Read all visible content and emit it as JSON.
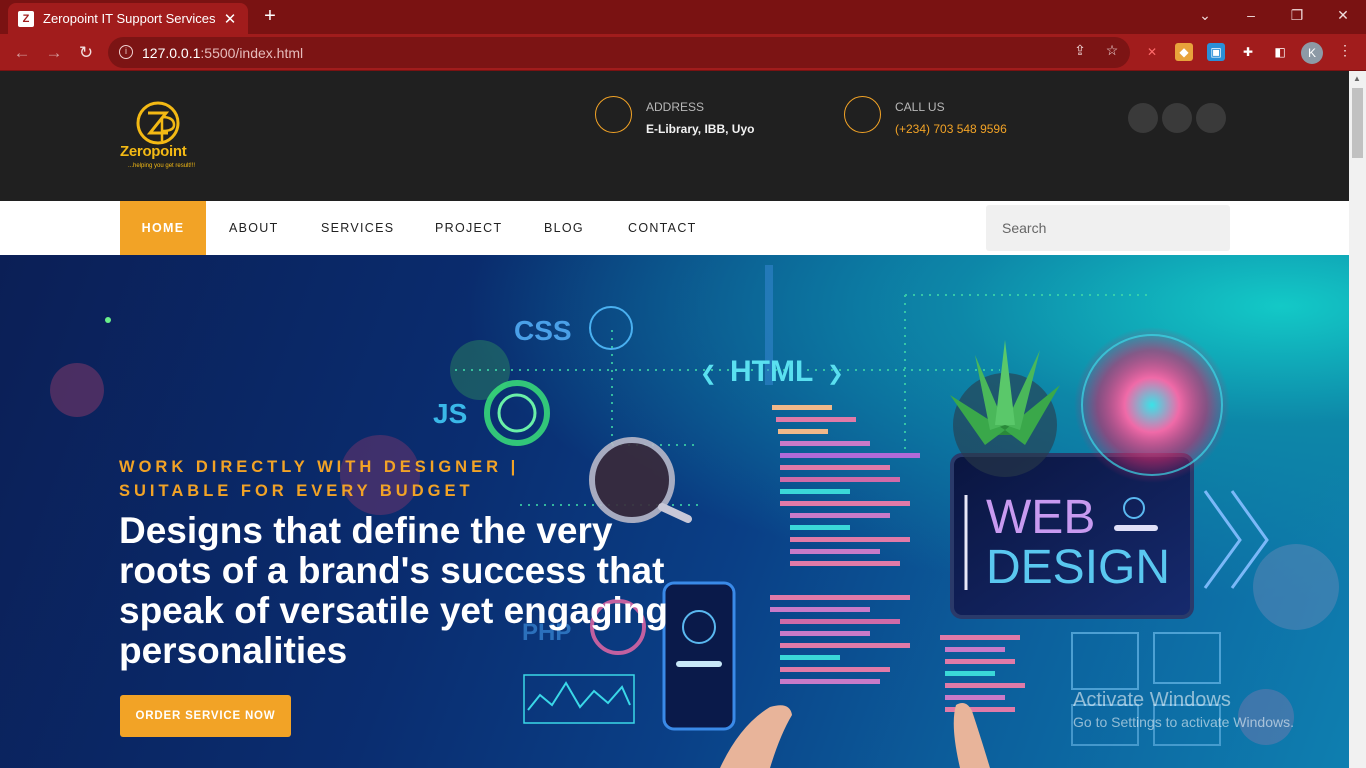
{
  "browser": {
    "tab_title": "Zeropoint IT Support Services",
    "tab_close": "✕",
    "new_tab": "+",
    "url_host": "127.0.0.1",
    "url_path": ":5500/index.html",
    "profile_initial": "K"
  },
  "header": {
    "logo_text": "Zeropoint",
    "logo_tagline": "...helping you get result!!!",
    "address_label": "ADDRESS",
    "address_value": "E-Library, IBB, Uyo",
    "call_label": "CALL US",
    "call_value": "(+234) 703 548 9596"
  },
  "nav": {
    "items": [
      "HOME",
      "ABOUT",
      "SERVICES",
      "PROJECT",
      "BLOG",
      "CONTACT"
    ],
    "search_placeholder": "Search"
  },
  "hero": {
    "subtitle": "WORK DIRECTLY WITH DESIGNER | SUITABLE FOR EVERY BUDGET",
    "title": "Designs that define the very roots of a brand's success that speak of versatile yet engaging personalities",
    "cta_label": "ORDER SERVICE NOW",
    "art_labels": {
      "css": "CSS",
      "html": "HTML",
      "js": "JS",
      "php": "PHP",
      "web": "WEB",
      "design": "DESIGN"
    }
  },
  "os_overlay": {
    "line1": "Activate Windows",
    "line2": "Go to Settings to activate Windows."
  },
  "colors": {
    "accent": "#f2a326",
    "browser_frame": "#a11c1c",
    "header_bg": "#202020"
  }
}
